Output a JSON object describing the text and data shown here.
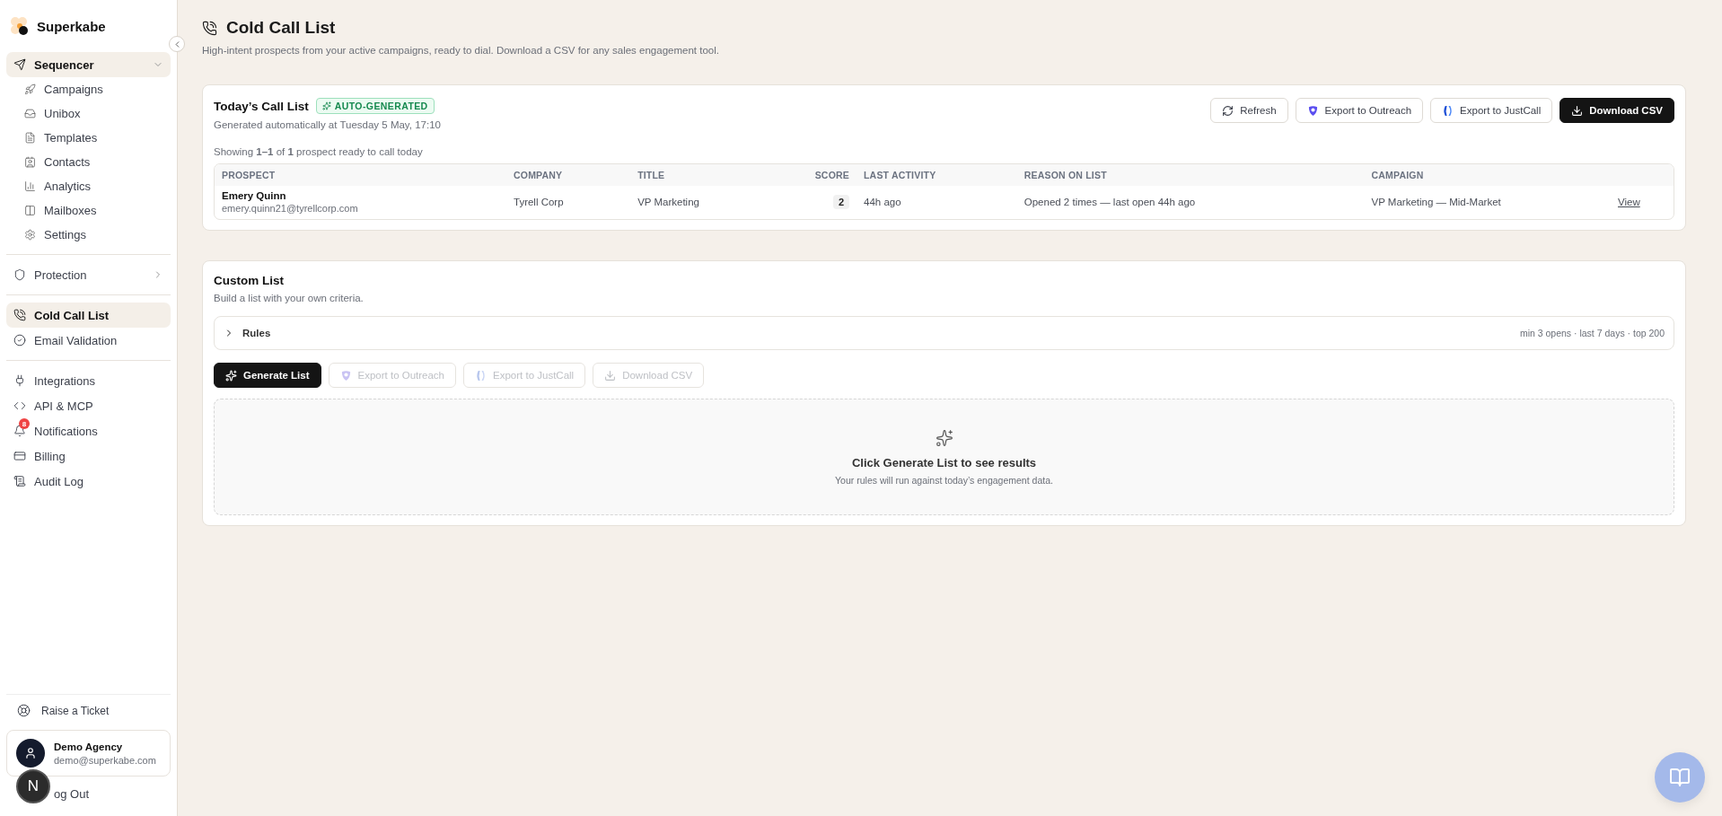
{
  "sidebar": {
    "brand": "Superkabe",
    "sections": [
      [
        {
          "label": "Sequencer",
          "kind": "group",
          "expanded": true,
          "children": [
            {
              "label": "Campaigns"
            },
            {
              "label": "Unibox"
            },
            {
              "label": "Templates"
            },
            {
              "label": "Contacts"
            },
            {
              "label": "Analytics"
            },
            {
              "label": "Mailboxes"
            },
            {
              "label": "Settings"
            }
          ]
        }
      ],
      [
        {
          "label": "Protection",
          "kind": "group",
          "expanded": false
        }
      ],
      [
        {
          "label": "Cold Call List",
          "kind": "item",
          "selected": true
        },
        {
          "label": "Email Validation",
          "kind": "item",
          "selected": false
        }
      ],
      [
        {
          "label": "Integrations",
          "kind": "item",
          "selected": false
        },
        {
          "label": "API & MCP",
          "kind": "item",
          "selected": false
        },
        {
          "label": "Notifications",
          "kind": "item",
          "selected": false,
          "badge": "8"
        },
        {
          "label": "Billing",
          "kind": "item",
          "selected": false
        },
        {
          "label": "Audit Log",
          "kind": "item",
          "selected": false
        }
      ]
    ],
    "support": "Raise a Ticket",
    "account": {
      "name": "Demo Agency",
      "email": "demo@superkabe.com"
    },
    "logout": "og Out",
    "dev_badge": "N"
  },
  "page": {
    "title": "Cold Call List",
    "subtitle": "High-intent prospects from your active campaigns, ready to dial. Download a CSV for any sales engagement tool."
  },
  "todays_list": {
    "title": "Today’s Call List",
    "tag": "AUTO-GENERATED",
    "generated": "Generated automatically at Tuesday 5 May, 17:10",
    "actions": [
      {
        "label": "Refresh",
        "kind": "refresh"
      },
      {
        "label": "Export to Outreach",
        "kind": "outreach"
      },
      {
        "label": "Export to JustCall",
        "kind": "justcall"
      },
      {
        "label": "Download CSV",
        "kind": "download"
      }
    ],
    "showing": "Showing **1–1** of **1** prospect ready to call today",
    "table": {
      "columns": [
        "PROSPECT",
        "COMPANY",
        "TITLE",
        "SCORE",
        "LAST ACTIVITY",
        "REASON ON LIST",
        "CAMPAIGN"
      ],
      "rows": [
        {
          "name": "Emery Quinn",
          "email": "emery.quinn21@tyrellcorp.com",
          "company": "Tyrell Corp",
          "title": "VP Marketing",
          "score": "2",
          "last_activity": "44h ago",
          "reason": "Opened 2 times — last open 44h ago",
          "campaign": "VP Marketing — Mid-Market",
          "action": "View"
        }
      ]
    }
  },
  "custom_list": {
    "title": "Custom List",
    "subtitle": "Build a list with your own criteria.",
    "rules": {
      "label": "Rules",
      "expanded": false,
      "summary": "min 3 opens · last 7 days · top 200"
    },
    "actions": [
      {
        "label": "Generate List",
        "kind": "generate",
        "disabled": false
      },
      {
        "label": "Export to Outreach",
        "kind": "outreach",
        "disabled": true
      },
      {
        "label": "Export to JustCall",
        "kind": "justcall",
        "disabled": true
      },
      {
        "label": "Download CSV",
        "kind": "download",
        "disabled": true
      }
    ],
    "empty_title": "Click Generate List to see results",
    "empty_text": "Your rules will run against today’s engagement data."
  }
}
